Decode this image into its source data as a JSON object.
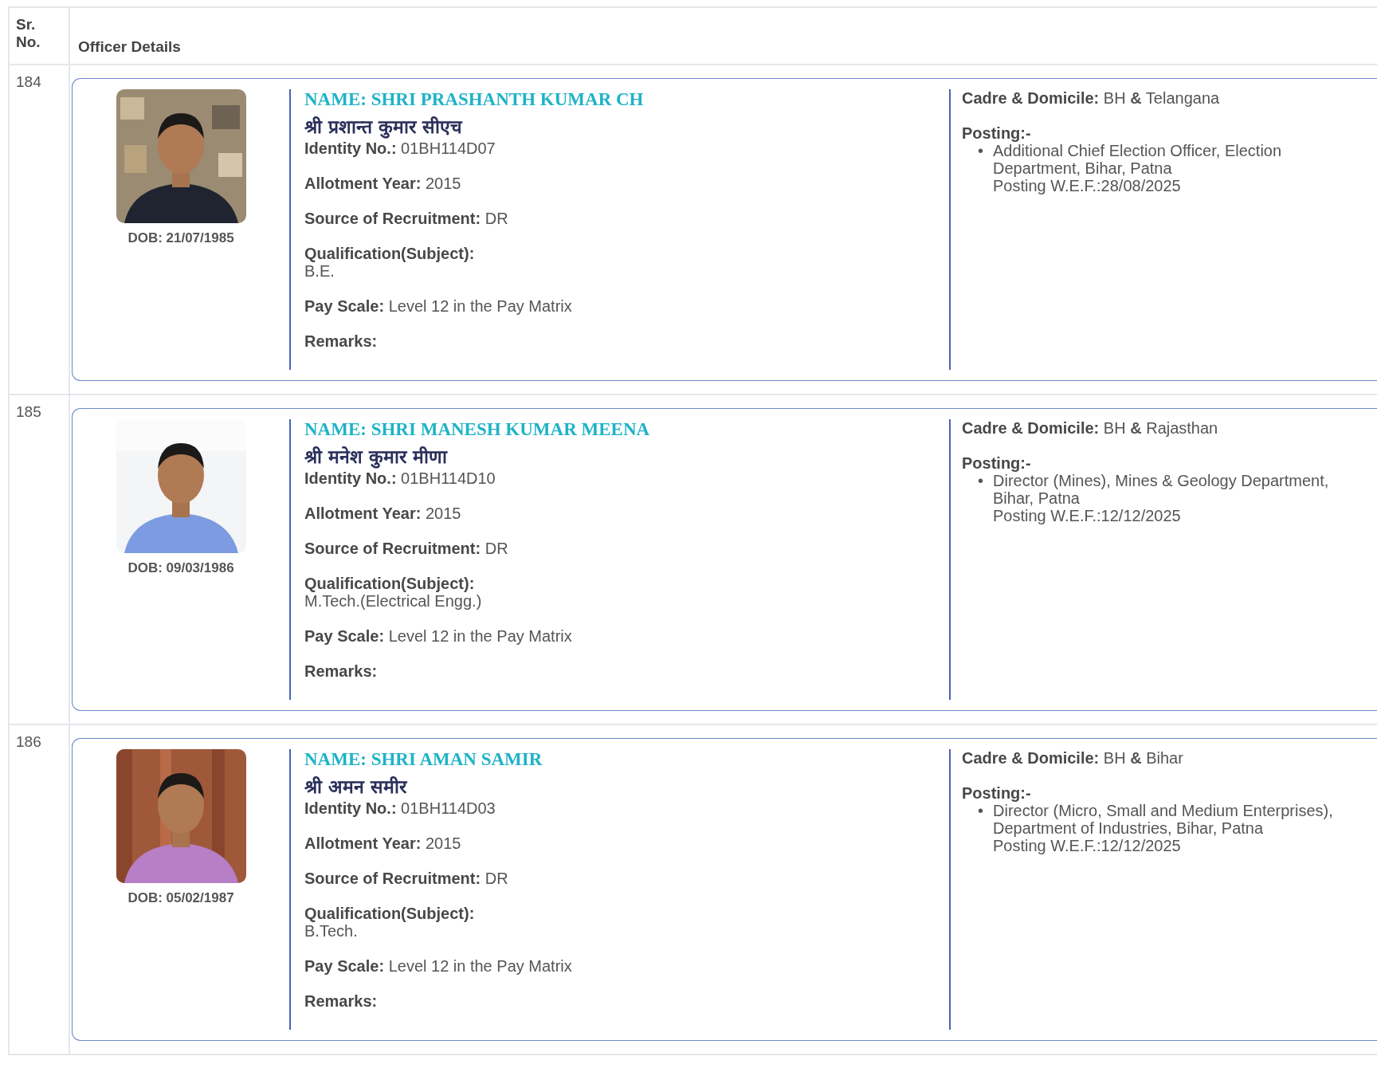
{
  "table": {
    "columns": [
      "Sr.\nNo.",
      "Officer Details"
    ],
    "rows": [
      {
        "sr_no": "184",
        "dob": "DOB: 21/07/1985",
        "name": "NAME: SHRI PRASHANTH KUMAR CH",
        "hindi_name": "श्री प्रशान्त कुमार सीएच",
        "fields": [
          {
            "label": "Identity No.:",
            "value": "01BH114D07"
          },
          {
            "label": "Allotment Year:",
            "value": "2015"
          },
          {
            "label": "Source of Recruitment:",
            "value": "DR"
          },
          {
            "label": "Qualification(Subject):",
            "value": "B.E.",
            "kind": "stacked"
          },
          {
            "label": "Pay Scale:",
            "value": "Level 12 in the Pay Matrix"
          },
          {
            "label": "Remarks:"
          }
        ],
        "cadre_label": "Cadre & Domicile:",
        "cadre_domicile": "BH **&** Telangana",
        "posting_label": "Posting:-",
        "postings": [
          {
            "marker": "•",
            "post": "Additional Chief Election Officer, Election Department, Bihar, Patna",
            "wef": "Posting W.E.F.:28/08/2025"
          }
        ]
      },
      {
        "sr_no": "185",
        "dob": "DOB: 09/03/1986",
        "name": "NAME: SHRI MANESH KUMAR MEENA",
        "hindi_name": "श्री मनेश कुमार मीणा",
        "fields": [
          {
            "label": "Identity No.:",
            "value": "01BH114D10"
          },
          {
            "label": "Allotment Year:",
            "value": "2015"
          },
          {
            "label": "Source of Recruitment:",
            "value": "DR"
          },
          {
            "label": "Qualification(Subject):",
            "value": "M.Tech.(Electrical Engg.)",
            "kind": "stacked"
          },
          {
            "label": "Pay Scale:",
            "value": "Level 12 in the Pay Matrix"
          },
          {
            "label": "Remarks:"
          }
        ],
        "cadre_label": "Cadre & Domicile:",
        "cadre_domicile": "BH **&** Rajasthan",
        "posting_label": "Posting:-",
        "postings": [
          {
            "marker": "•",
            "post": "Director (Mines), Mines & Geology Department, Bihar, Patna",
            "wef": "Posting W.E.F.:12/12/2025"
          }
        ]
      },
      {
        "sr_no": "186",
        "dob": "DOB: 05/02/1987",
        "name": "NAME: SHRI AMAN SAMIR",
        "hindi_name": "श्री अमन समीर",
        "fields": [
          {
            "label": "Identity No.:",
            "value": "01BH114D03"
          },
          {
            "label": "Allotment Year:",
            "value": "2015"
          },
          {
            "label": "Source of Recruitment:",
            "value": "DR"
          },
          {
            "label": "Qualification(Subject):",
            "value": "B.Tech.",
            "kind": "stacked"
          },
          {
            "label": "Pay Scale:",
            "value": "Level 12 in the Pay Matrix"
          },
          {
            "label": "Remarks:"
          }
        ],
        "cadre_label": "Cadre & Domicile:",
        "cadre_domicile": "BH **&** Bihar",
        "posting_label": "Posting:-",
        "postings": [
          {
            "marker": "•",
            "post": "Director (Micro, Small and Medium Enterprises), Department of Industries, Bihar, Patna",
            "wef": "Posting W.E.F.:12/12/2025"
          }
        ]
      }
    ]
  }
}
